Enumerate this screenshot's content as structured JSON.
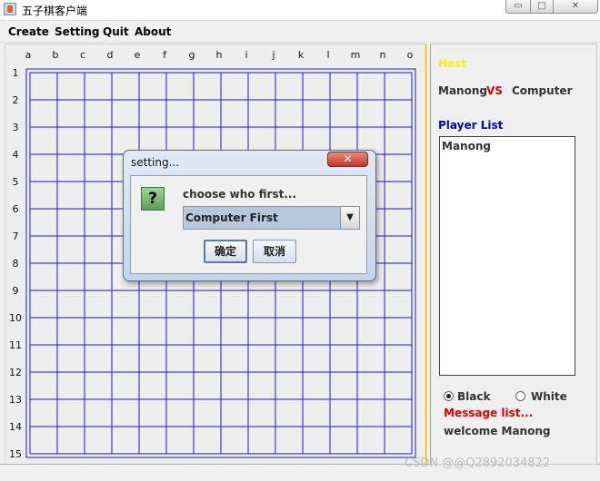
{
  "window": {
    "title": "五子棋客户端",
    "min_glyph": "▭",
    "max_glyph": "□",
    "close_glyph": "✕"
  },
  "menu": {
    "create": "Create",
    "setting": "Setting",
    "quit": "Quit",
    "about": "About"
  },
  "board": {
    "columns": [
      "a",
      "b",
      "c",
      "d",
      "e",
      "f",
      "g",
      "h",
      "i",
      "j",
      "k",
      "l",
      "m",
      "n",
      "o"
    ],
    "rows": [
      "1",
      "2",
      "3",
      "4",
      "5",
      "6",
      "7",
      "8",
      "9",
      "10",
      "11",
      "12",
      "13",
      "14",
      "15"
    ],
    "line_color": "#1a1ad0"
  },
  "side": {
    "host": "Host",
    "player1": "Manong",
    "vs": "VS",
    "player2": "Computer",
    "player_list_label": "Player List",
    "player_list": [
      "Manong"
    ],
    "black_label": "Black",
    "white_label": "White",
    "selected_color": "Black",
    "message_list_label": "Message list...",
    "message": "welcome Manong"
  },
  "dialog": {
    "title": "setting...",
    "close_glyph": "✕",
    "message": "choose who first...",
    "selected_option": "Computer First",
    "arrow_glyph": "▼",
    "ok_label": "确定",
    "cancel_label": "取消",
    "icon_glyph": "?"
  },
  "watermark": "CSDN @@Q2892034822"
}
